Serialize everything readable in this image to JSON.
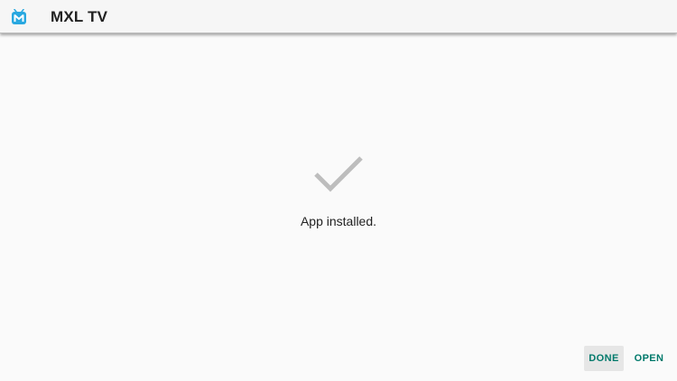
{
  "app": {
    "title": "MXL TV",
    "icon": "mxl-logo-icon",
    "accent_color": "#00796b"
  },
  "status": {
    "icon": "checkmark-icon",
    "message": "App installed."
  },
  "actions": {
    "done_label": "DONE",
    "open_label": "OPEN"
  }
}
